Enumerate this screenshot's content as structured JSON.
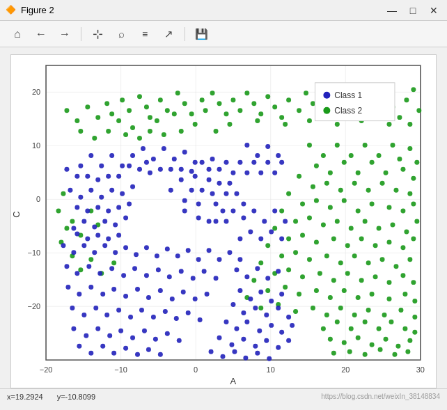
{
  "titleBar": {
    "title": "Figure 2",
    "icon": "🔶",
    "controls": {
      "minimize": "—",
      "maximize": "□",
      "close": "✕"
    }
  },
  "toolbar": {
    "buttons": [
      {
        "name": "home",
        "icon": "⌂",
        "label": "Home"
      },
      {
        "name": "back",
        "icon": "←",
        "label": "Back"
      },
      {
        "name": "forward",
        "icon": "→",
        "label": "Forward"
      },
      {
        "name": "pan",
        "icon": "✛",
        "label": "Pan"
      },
      {
        "name": "zoom",
        "icon": "🔍",
        "label": "Zoom"
      },
      {
        "name": "settings",
        "icon": "⚙",
        "label": "Configure"
      },
      {
        "name": "graph",
        "icon": "📈",
        "label": "Edit curves"
      },
      {
        "name": "save",
        "icon": "💾",
        "label": "Save"
      }
    ]
  },
  "plot": {
    "xLabel": "A",
    "yLabel": "C",
    "xMin": -20,
    "xMax": 30,
    "yMin": -30,
    "yMax": 25,
    "legend": [
      {
        "label": "Class 1",
        "color": "#2020cc"
      },
      {
        "label": "Class 2",
        "color": "#00aa00"
      }
    ]
  },
  "statusBar": {
    "x": "x=19.2924",
    "y": "y=-10.8099",
    "url": "https://blog.csdn.net/weixIn_38148834"
  }
}
